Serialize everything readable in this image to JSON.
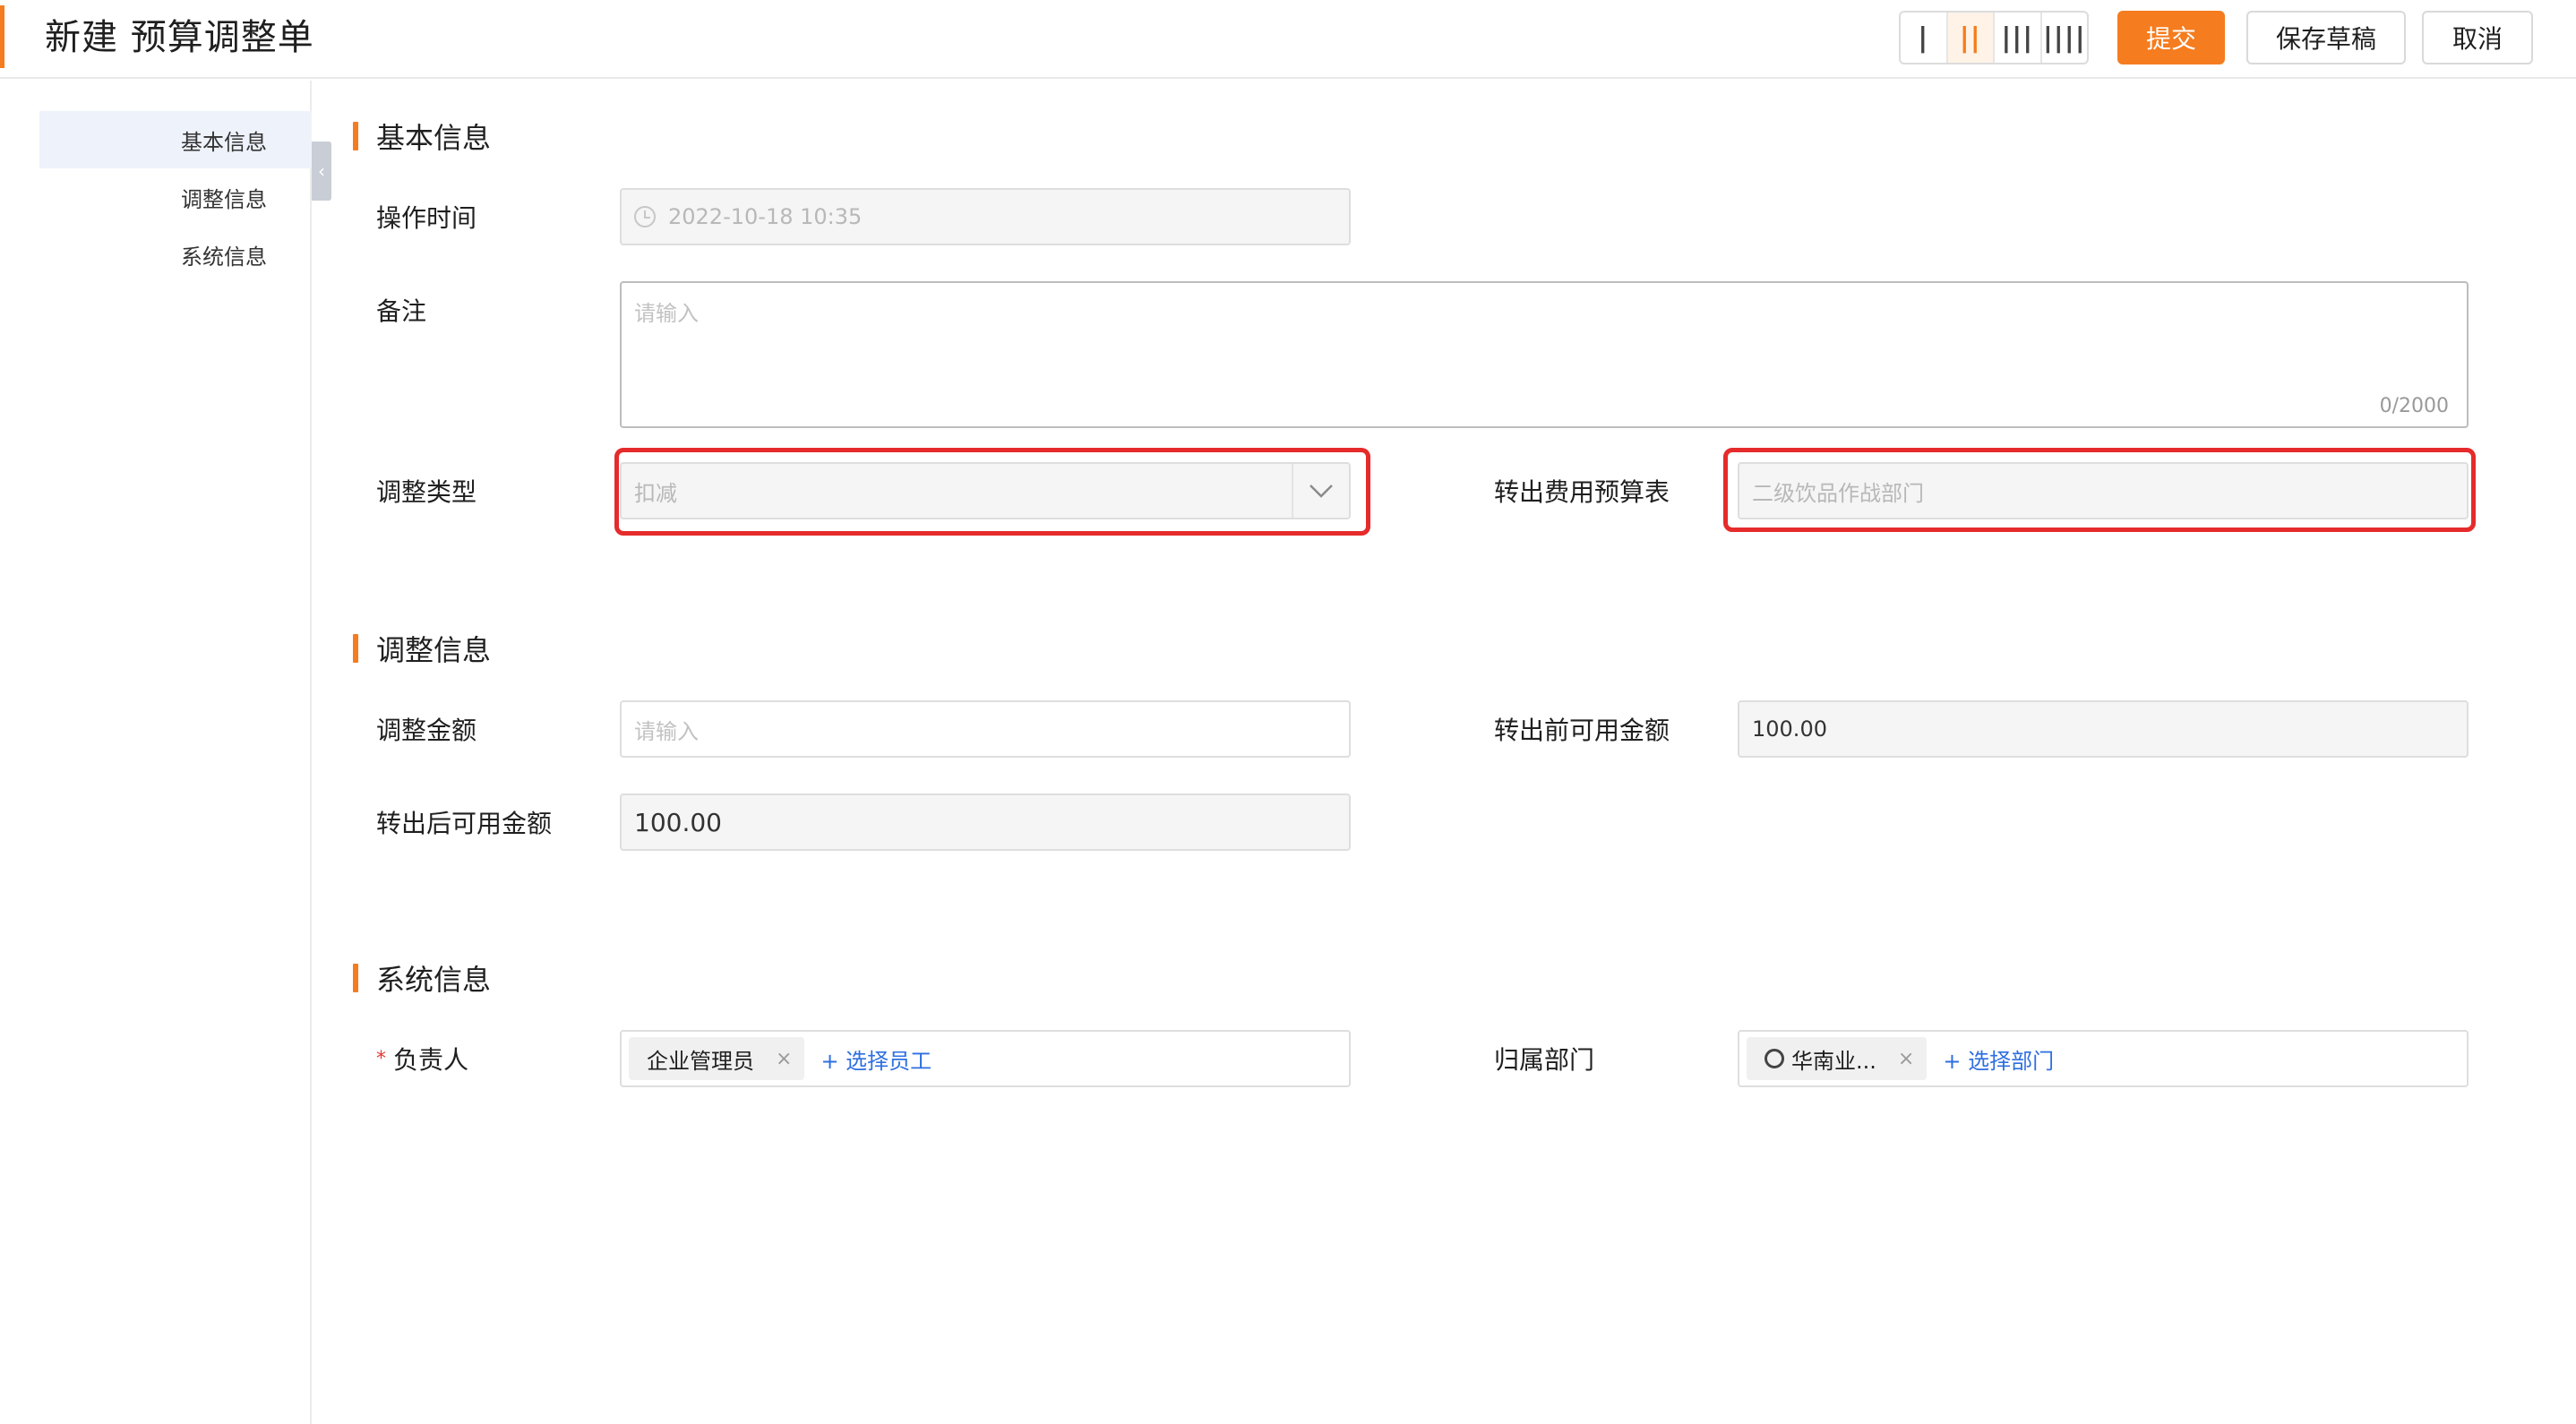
{
  "header": {
    "title": "新建 预算调整单",
    "layout_options": [
      "|",
      "||",
      "|||",
      "||||"
    ],
    "submit_label": "提交",
    "draft_label": "保存草稿",
    "cancel_label": "取消"
  },
  "sidebar": {
    "items": [
      {
        "label": "基本信息",
        "active": true
      },
      {
        "label": "调整信息",
        "active": false
      },
      {
        "label": "系统信息",
        "active": false
      }
    ],
    "collapse_icon": "‹"
  },
  "sections": {
    "basic": {
      "title": "基本信息",
      "op_time_label": "操作时间",
      "op_time_value": "2022-10-18 10:35",
      "remark_label": "备注",
      "remark_placeholder": "请输入",
      "remark_counter": "0/2000",
      "adjust_type_label": "调整类型",
      "adjust_type_value": "扣减",
      "out_budget_label": "转出费用预算表",
      "out_budget_value": "二级饮品作战部门"
    },
    "adjust": {
      "title": "调整信息",
      "amount_label": "调整金额",
      "amount_placeholder": "请输入",
      "before_label": "转出前可用金额",
      "before_value": "100.00",
      "after_label": "转出后可用金额",
      "after_value": "100.00"
    },
    "system": {
      "title": "系统信息",
      "owner_required": "*",
      "owner_label": "负责人",
      "owner_tag": "企业管理员",
      "owner_add": "+ 选择员工",
      "dept_label": "归属部门",
      "dept_tag": "华南业...",
      "dept_add": "+ 选择部门",
      "tag_remove": "×"
    }
  },
  "colors": {
    "accent": "#f57c1f",
    "highlight": "#e52b2b",
    "link": "#2f6fe0"
  }
}
